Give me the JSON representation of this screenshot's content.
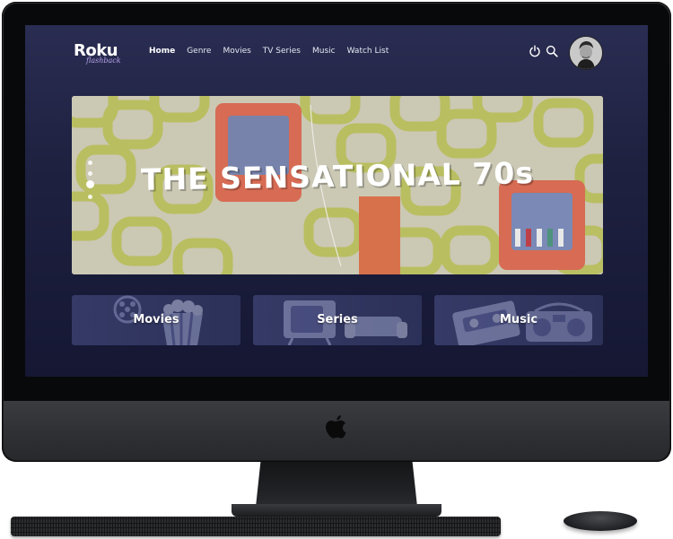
{
  "brand": {
    "name": "Roku",
    "subtitle": "flashback"
  },
  "nav": {
    "links": [
      {
        "label": "Home",
        "active": true
      },
      {
        "label": "Genre",
        "active": false
      },
      {
        "label": "Movies",
        "active": false
      },
      {
        "label": "TV Series",
        "active": false
      },
      {
        "label": "Music",
        "active": false
      },
      {
        "label": "Watch List",
        "active": false
      }
    ],
    "icons": [
      "power-icon",
      "search-icon",
      "user-avatar"
    ]
  },
  "hero": {
    "title": "THE SENSATIONAL 70s",
    "slide_count": 4,
    "active_slide": 2
  },
  "categories": [
    {
      "label": "Movies",
      "icon": "film-reel-popcorn"
    },
    {
      "label": "Series",
      "icon": "tv-sofa"
    },
    {
      "label": "Music",
      "icon": "cassette-boombox"
    }
  ],
  "colors": {
    "screen_bg": "#1e2140",
    "tile_bg": "#353a66",
    "accent": "#b8a2ea",
    "hero_pattern_green": "#b0b845",
    "hero_pattern_bg": "#c7c4ae",
    "hero_shelf": "#d45f45"
  }
}
